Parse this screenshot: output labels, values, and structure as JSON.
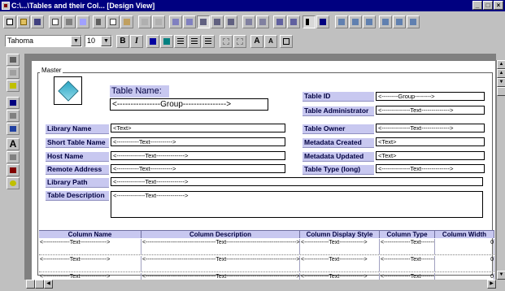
{
  "window": {
    "title": "C:\\...\\Tables and their Col... [Design View]"
  },
  "toolbar": {
    "font_name": "Tahoma",
    "font_size": "10",
    "bold_label": "B",
    "italic_label": "I"
  },
  "section": {
    "label": "Master"
  },
  "form": {
    "table_name_label": "Table Name:",
    "table_name_value": "<----------------Group---------------->",
    "left_fields": [
      {
        "label": "Library Name",
        "value": "<Text>"
      },
      {
        "label": "Short Table Name",
        "value": "<-----------Text----------->"
      },
      {
        "label": "Host Name",
        "value": "<--------------Text-------------->"
      },
      {
        "label": "Remote Address",
        "value": "<-----------Text----------->"
      },
      {
        "label": "Library Path",
        "value": "<--------------Text-------------->"
      },
      {
        "label": "Table Description",
        "value": "<--------------Text-------------->"
      }
    ],
    "right_fields": [
      {
        "label": "Table ID",
        "value": "<--------Group-------->"
      },
      {
        "label": "Table Administrator",
        "value": "<--------------Text-------------->"
      },
      {
        "label": "Table Owner",
        "value": "<--------------Text-------------->"
      },
      {
        "label": "Metadata Created",
        "value": "<Text>"
      },
      {
        "label": "Metadata Updated",
        "value": "<Text>"
      },
      {
        "label": "Table Type (long)",
        "value": "<--------------Text-------------->"
      }
    ]
  },
  "grid": {
    "columns": [
      "Column Name",
      "Column Description",
      "Column Display Style",
      "Column Type",
      "Column Width"
    ],
    "rows": [
      [
        "<--------------Text-------------->",
        "<-------------------------------------Text------------------------------------->",
        "<-------------Text------------->",
        "<--------------Text-------------->",
        "0"
      ],
      [
        "<--------------Text-------------->",
        "<-------------------------------------Text------------------------------------->",
        "<-------------Text------------->",
        "<--------------Text-------------->",
        "0"
      ],
      [
        "<--------------Text-------------->",
        "<-------------------------------------Text------------------------------------->",
        "<-------------Text------------->",
        "<--------------Text-------------->",
        "0"
      ]
    ]
  }
}
